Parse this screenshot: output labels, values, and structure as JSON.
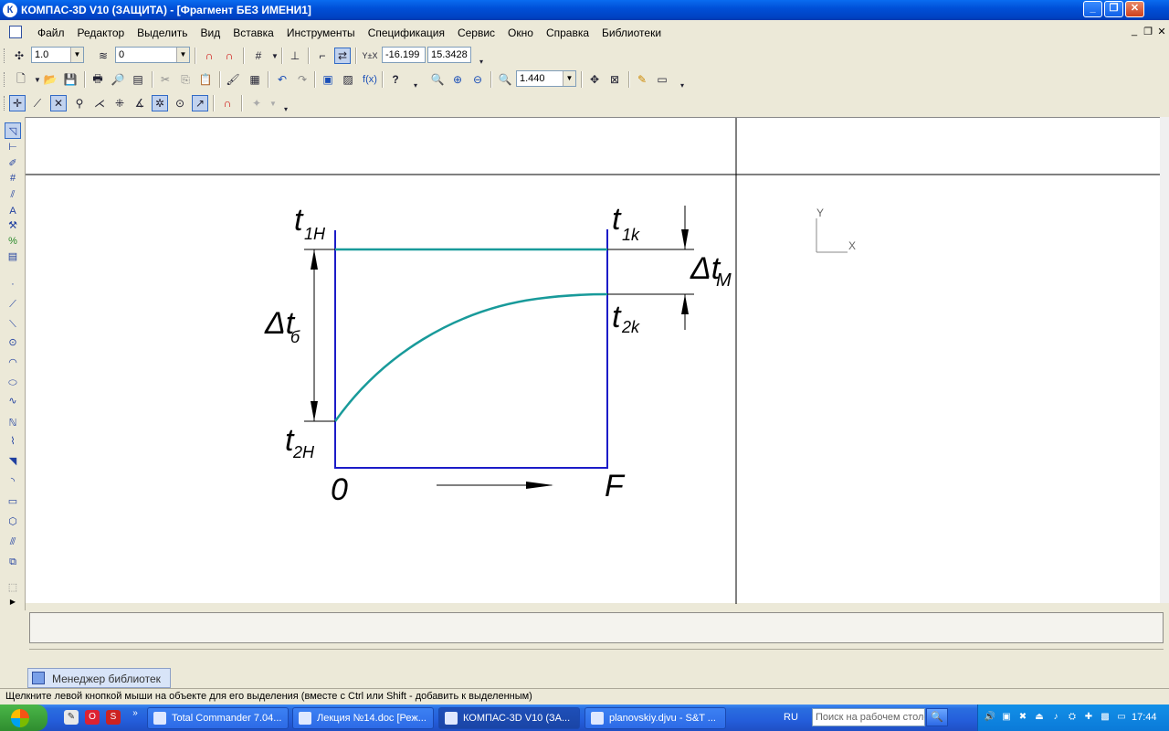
{
  "window": {
    "title": "КОМПАС-3D V10 (ЗАЩИТА) - [Фрагмент БЕЗ ИМЕНИ1]",
    "app_icon_letter": "К",
    "controls": {
      "minimize": "_",
      "maximize": "❐",
      "close": "✕"
    }
  },
  "menu": {
    "items": [
      "Файл",
      "Редактор",
      "Выделить",
      "Вид",
      "Вставка",
      "Инструменты",
      "Спецификация",
      "Сервис",
      "Окно",
      "Справка",
      "Библиотеки"
    ],
    "mdi": {
      "minimize": "_",
      "restore": "❐",
      "close": "✕"
    }
  },
  "toolbar1": {
    "step_value": "1.0",
    "layer_value": "0",
    "coord_x": "-16.199",
    "coord_y": "15.3428",
    "coord_label": "Y±X"
  },
  "toolbar2": {
    "zoom_value": "1.440",
    "fx_label": "f(x)",
    "help_label": "?"
  },
  "drawing": {
    "labels": {
      "t1n": "t",
      "t1n_sub": "1H",
      "t1k": "t",
      "t1k_sub": "1k",
      "t2k": "t",
      "t2k_sub": "2k",
      "t2n": "t",
      "t2n_sub": "2H",
      "dtb": "Δt",
      "dtb_sub": "б",
      "dtm": "Δt",
      "dtm_sub": "M",
      "origin": "0",
      "axis_end": "F"
    },
    "axes_icon": {
      "y": "Y",
      "x": "X"
    },
    "colors": {
      "frame": "#1c1cc8",
      "curve": "#189a9a",
      "dim": "#000000"
    }
  },
  "library_manager": {
    "label": "Менеджер библиотек"
  },
  "status": {
    "text": "Щелкните левой кнопкой мыши на объекте для его выделения (вместе с Ctrl или Shift - добавить к выделенным)"
  },
  "taskbar": {
    "quicklaunch_more": "»",
    "buttons": [
      {
        "label": "Total Commander 7.04..."
      },
      {
        "label": "Лекция №14.doc [Реж..."
      },
      {
        "label": "КОМПАС-3D V10 (ЗА..."
      },
      {
        "label": "planovskiy.djvu - S&T ..."
      }
    ],
    "lang": "RU",
    "search_placeholder": "Поиск на рабочем столе",
    "search_icon": "🔍",
    "clock": "17:44"
  }
}
